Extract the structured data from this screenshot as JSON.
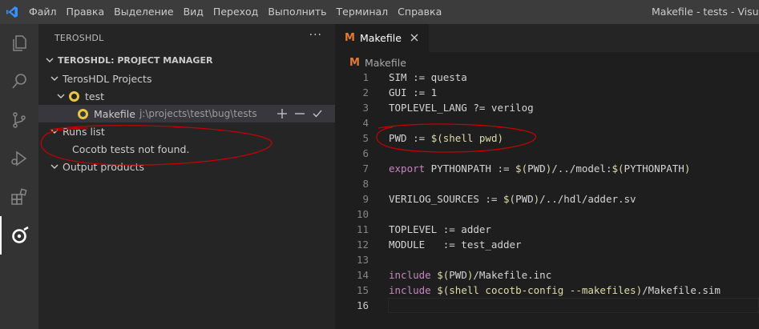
{
  "titlebar": {
    "menu": [
      "Файл",
      "Правка",
      "Выделение",
      "Вид",
      "Переход",
      "Выполнить",
      "Терминал",
      "Справка"
    ],
    "window_title": "Makefile - tests - Visual S"
  },
  "activity_icons": [
    "explorer-icon",
    "search-icon",
    "source-control-icon",
    "run-debug-icon",
    "extensions-icon",
    "teroshdl-icon"
  ],
  "sidebar": {
    "title": "TEROSHDL",
    "more": "···",
    "section_title": "TEROSHDL: PROJECT MANAGER",
    "projects_label": "TerosHDL Projects",
    "project_name": "test",
    "file_name": "Makefile",
    "file_path": "j:\\projects\\test\\bug\\tests",
    "runs_label": "Runs list",
    "runs_message": "Cocotb tests not found.",
    "outputs_label": "Output products"
  },
  "editor": {
    "tab_label": "Makefile",
    "breadcrumb": "Makefile",
    "lines": [
      {
        "n": "1",
        "segs": [
          {
            "t": "SIM := questa",
            "c": ""
          }
        ]
      },
      {
        "n": "2",
        "segs": [
          {
            "t": "GUI := 1",
            "c": ""
          }
        ]
      },
      {
        "n": "3",
        "segs": [
          {
            "t": "TOPLEVEL_LANG ?= verilog",
            "c": ""
          }
        ]
      },
      {
        "n": "4",
        "segs": []
      },
      {
        "n": "5",
        "segs": [
          {
            "t": "PWD := ",
            "c": ""
          },
          {
            "t": "$(",
            "c": "fn"
          },
          {
            "t": "shell pwd",
            "c": "fn"
          },
          {
            "t": ")",
            "c": "fn"
          }
        ]
      },
      {
        "n": "6",
        "segs": []
      },
      {
        "n": "7",
        "segs": [
          {
            "t": "export",
            "c": "kw"
          },
          {
            "t": " PYTHONPATH := ",
            "c": ""
          },
          {
            "t": "$(",
            "c": "fn"
          },
          {
            "t": "PWD",
            "c": ""
          },
          {
            "t": ")",
            "c": "fn"
          },
          {
            "t": "/../model:",
            "c": ""
          },
          {
            "t": "$(",
            "c": "fn"
          },
          {
            "t": "PYTHONPATH",
            "c": ""
          },
          {
            "t": ")",
            "c": "fn"
          }
        ]
      },
      {
        "n": "8",
        "segs": []
      },
      {
        "n": "9",
        "segs": [
          {
            "t": "VERILOG_SOURCES := ",
            "c": ""
          },
          {
            "t": "$(",
            "c": "fn"
          },
          {
            "t": "PWD",
            "c": ""
          },
          {
            "t": ")",
            "c": "fn"
          },
          {
            "t": "/../hdl/adder.sv",
            "c": ""
          }
        ]
      },
      {
        "n": "10",
        "segs": []
      },
      {
        "n": "11",
        "segs": [
          {
            "t": "TOPLEVEL := adder",
            "c": ""
          }
        ]
      },
      {
        "n": "12",
        "segs": [
          {
            "t": "MODULE   := test_adder",
            "c": ""
          }
        ]
      },
      {
        "n": "13",
        "segs": []
      },
      {
        "n": "14",
        "segs": [
          {
            "t": "include",
            "c": "kw"
          },
          {
            "t": " ",
            "c": ""
          },
          {
            "t": "$(",
            "c": "fn"
          },
          {
            "t": "PWD",
            "c": ""
          },
          {
            "t": ")",
            "c": "fn"
          },
          {
            "t": "/Makefile.inc",
            "c": ""
          }
        ]
      },
      {
        "n": "15",
        "segs": [
          {
            "t": "include",
            "c": "kw"
          },
          {
            "t": " ",
            "c": ""
          },
          {
            "t": "$(",
            "c": "fn"
          },
          {
            "t": "shell cocotb-config --makefiles",
            "c": "fn"
          },
          {
            "t": ")",
            "c": "fn"
          },
          {
            "t": "/Makefile.sim",
            "c": ""
          }
        ]
      },
      {
        "n": "16",
        "segs": []
      }
    ]
  },
  "colors": {
    "accent_blue": "#3794ff",
    "annotation_red": "#cc0000",
    "makefile_orange": "#e37933",
    "teros_yellow": "#e8c640"
  }
}
